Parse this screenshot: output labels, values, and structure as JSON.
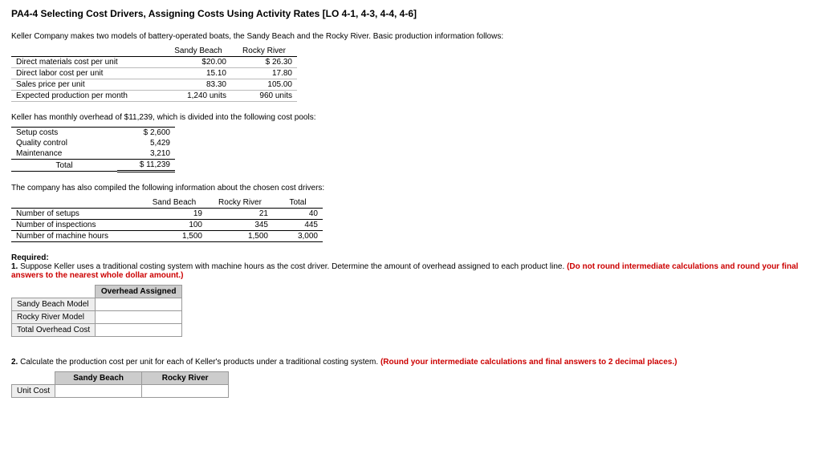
{
  "title": "PA4-4 Selecting Cost Drivers, Assigning Costs Using Activity Rates [LO 4-1, 4-3, 4-4, 4-6]",
  "intro": "Keller Company makes two models of battery-operated boats, the Sandy Beach and the Rocky River. Basic production information follows:",
  "prod": {
    "cols": [
      "Sandy Beach",
      "Rocky River"
    ],
    "rows": [
      {
        "label": "Direct materials cost per unit",
        "v": [
          "$20.00",
          "$ 26.30"
        ]
      },
      {
        "label": "Direct labor cost per unit",
        "v": [
          "15.10",
          "17.80"
        ]
      },
      {
        "label": "Sales price per unit",
        "v": [
          "83.30",
          "105.00"
        ]
      },
      {
        "label": "Expected production per month",
        "v": [
          "1,240 units",
          "960 units"
        ]
      }
    ]
  },
  "overhead_intro": "Keller has monthly overhead of $11,239, which is divided into the following cost pools:",
  "pools": {
    "rows": [
      {
        "label": "Setup costs",
        "val": "$   2,600"
      },
      {
        "label": "Quality control",
        "val": "5,429"
      },
      {
        "label": "Maintenance",
        "val": "3,210"
      }
    ],
    "total_label": "Total",
    "total_val": "$ 11,239"
  },
  "drivers_intro": "The company has also compiled the following information about the chosen cost drivers:",
  "drivers": {
    "cols": [
      "Sand Beach",
      "Rocky River",
      "Total"
    ],
    "rows": [
      {
        "label": "Number of setups",
        "v": [
          "19",
          "21",
          "40"
        ]
      },
      {
        "label": "Number of inspections",
        "v": [
          "100",
          "345",
          "445"
        ]
      },
      {
        "label": "Number of machine hours",
        "v": [
          "1,500",
          "1,500",
          "3,000"
        ]
      }
    ]
  },
  "required_label": "Required:",
  "q1": {
    "num": "1.",
    "text": " Suppose Keller uses a traditional costing system with machine hours as the cost driver. Determine the amount of overhead assigned to each product line. ",
    "note": "(Do not round intermediate calculations and round your final answers to the nearest whole dollar amount.)",
    "col": "Overhead Assigned",
    "rows": [
      "Sandy Beach Model",
      "Rocky River Model",
      "Total Overhead Cost"
    ]
  },
  "q2": {
    "num": "2.",
    "text": " Calculate the production cost per unit for each of Keller's products under a traditional costing system. ",
    "note": "(Round your intermediate calculations and final answers to 2 decimal places.)",
    "cols": [
      "Sandy Beach",
      "Rocky River"
    ],
    "row": "Unit Cost"
  }
}
